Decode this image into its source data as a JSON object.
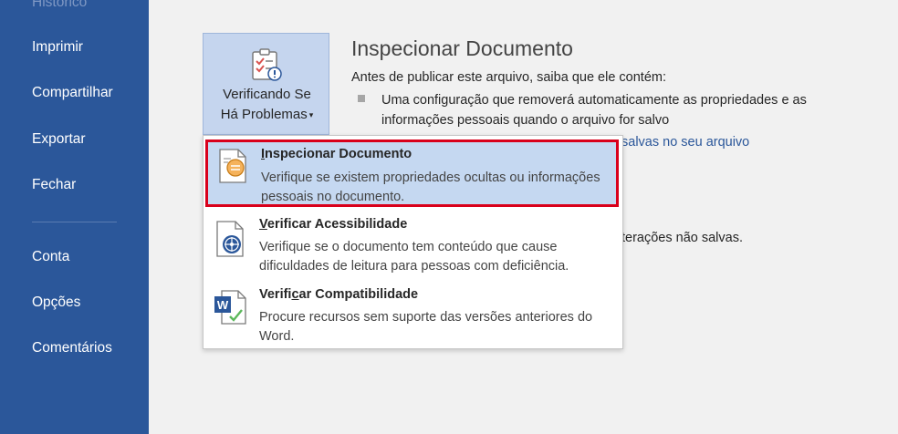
{
  "sidebar": {
    "items": [
      {
        "label": "Histórico"
      },
      {
        "label": "Imprimir"
      },
      {
        "label": "Compartilhar"
      },
      {
        "label": "Exportar"
      },
      {
        "label": "Fechar"
      },
      {
        "label": "Conta"
      },
      {
        "label": "Opções"
      },
      {
        "label": "Comentários"
      }
    ]
  },
  "check_button": {
    "line1": "Verificando Se",
    "line2": "Há Problemas",
    "caret": "▾"
  },
  "inspect_section": {
    "title": "Inspecionar Documento",
    "description": "Antes de publicar este arquivo, saiba que ele contém:",
    "bullet": "Uma configuração que removerá automaticamente as propriedades e as informações pessoais quando o arquivo for salvo",
    "link_fragment": "salvas no seu arquivo",
    "text_fragment": "terações não salvas."
  },
  "dropdown": {
    "items": [
      {
        "title_mn": "I",
        "title_rest": "nspecionar Documento",
        "description": "Verifique se existem propriedades ocultas ou informações pessoais no documento."
      },
      {
        "title_mn": "V",
        "title_rest": "erificar Acessibilidade",
        "description": "Verifique se o documento tem conteúdo que cause dificuldades de leitura para pessoas com deficiência."
      },
      {
        "title_pre": "Verifi",
        "title_mn": "c",
        "title_rest": "ar Compatibilidade",
        "description": "Procure recursos sem suporte das versões anteriores do Word."
      }
    ]
  },
  "colors": {
    "sidebar_bg": "#2b579a",
    "highlight_bg": "#c5d8f1",
    "highlight_border": "#d9001b",
    "link": "#2b579a"
  }
}
